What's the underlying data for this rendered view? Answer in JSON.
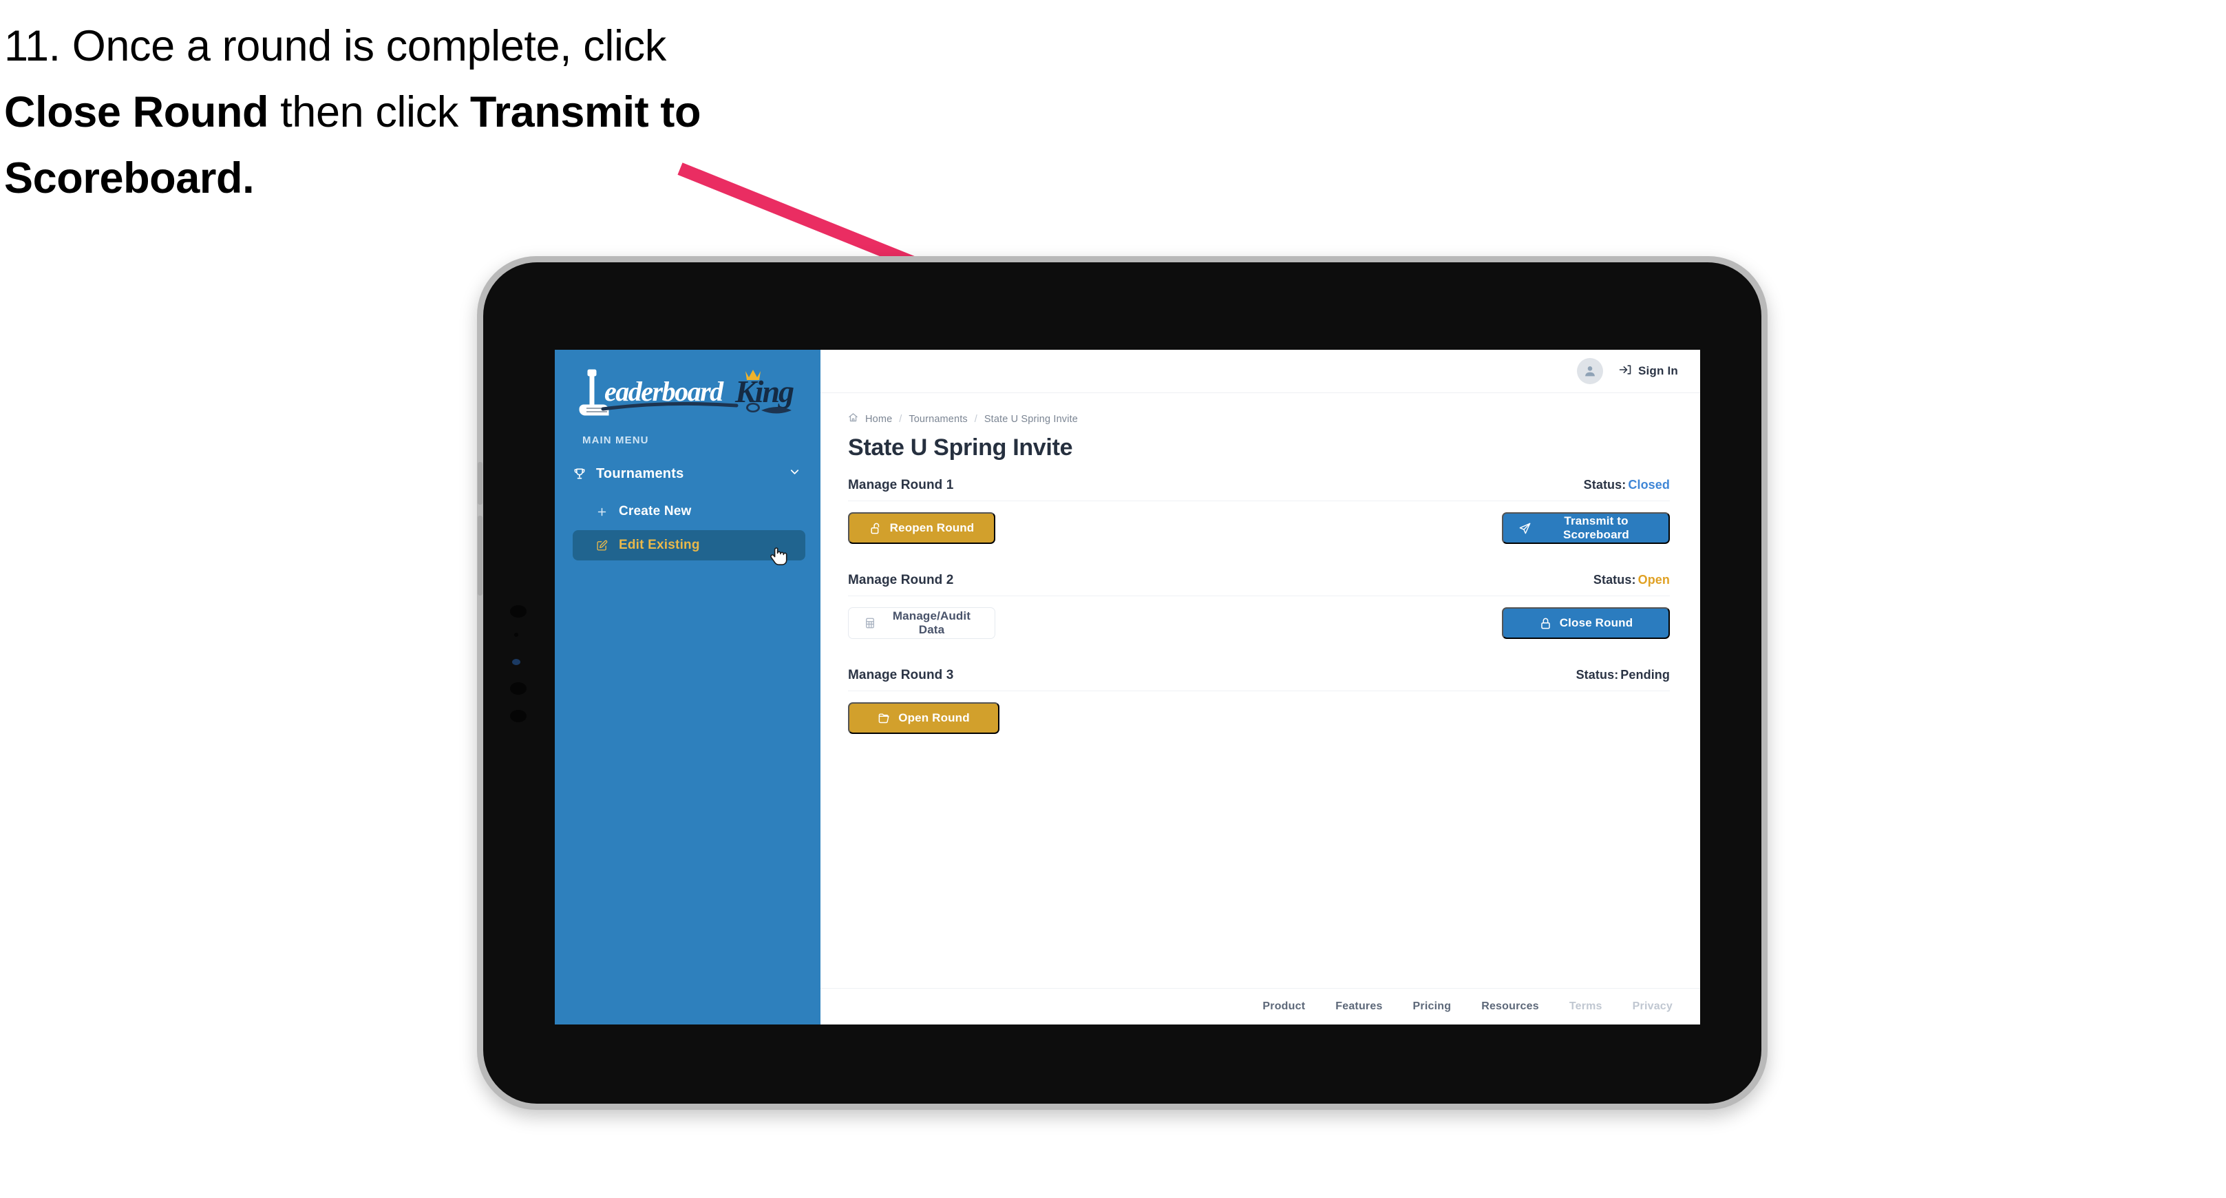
{
  "caption": {
    "part1": "11. Once a round is complete, click ",
    "bold1": "Close Round",
    "part2": " then click ",
    "bold2": "Transmit to Scoreboard."
  },
  "annotation": {
    "arrow_color": "#ea2d62"
  },
  "device": {
    "frame_color": "#b9b9b9",
    "bezel_color": "#0d0d0d"
  },
  "sidebar": {
    "brand": {
      "word1": "Leaderboard",
      "word2": "King",
      "bg_color": "#2e80bd"
    },
    "section_label": "MAIN MENU",
    "items": [
      {
        "label": "Tournaments",
        "icon": "trophy-icon",
        "expanded": true
      },
      {
        "label": "Create New",
        "icon": "plus-icon",
        "active": false
      },
      {
        "label": "Edit Existing",
        "icon": "edit-square-icon",
        "active": true
      }
    ],
    "active_color": "#e9b84a",
    "active_bg": "#20648f"
  },
  "topbar": {
    "avatar_icon": "user-icon",
    "signin_icon": "sign-in-arrow-icon",
    "signin_label": "Sign In"
  },
  "breadcrumb": {
    "home_icon": "home-icon",
    "items": [
      "Home",
      "Tournaments",
      "State U Spring Invite"
    ],
    "separator": "/"
  },
  "page": {
    "title": "State U Spring Invite"
  },
  "rounds": [
    {
      "title": "Manage Round 1",
      "status_label": "Status:",
      "status_value": "Closed",
      "status_class": "st-closed",
      "left_button": {
        "label": "Reopen Round",
        "icon": "unlock-icon",
        "style": "gold",
        "width": "w-reopen"
      },
      "right_button": {
        "label": "Transmit to Scoreboard",
        "icon": "paper-plane-icon",
        "style": "blue",
        "width": "w-transmit"
      }
    },
    {
      "title": "Manage Round 2",
      "status_label": "Status:",
      "status_value": "Open",
      "status_class": "st-open",
      "left_button": {
        "label": "Manage/Audit Data",
        "icon": "table-grid-icon",
        "style": "ghost",
        "width": "w-audit"
      },
      "right_button": {
        "label": "Close Round",
        "icon": "lock-icon",
        "style": "blue",
        "width": "w-close"
      }
    },
    {
      "title": "Manage Round 3",
      "status_label": "Status:",
      "status_value": "Pending",
      "status_class": "st-pending",
      "left_button": {
        "label": "Open Round",
        "icon": "folder-open-icon",
        "style": "gold",
        "width": "w-open"
      },
      "right_button": null
    }
  ],
  "footer": {
    "links": [
      {
        "label": "Product",
        "muted": false
      },
      {
        "label": "Features",
        "muted": false
      },
      {
        "label": "Pricing",
        "muted": false
      },
      {
        "label": "Resources",
        "muted": false
      },
      {
        "label": "Terms",
        "muted": true
      },
      {
        "label": "Privacy",
        "muted": true
      }
    ]
  },
  "cursor": {
    "type": "pointing-hand"
  }
}
